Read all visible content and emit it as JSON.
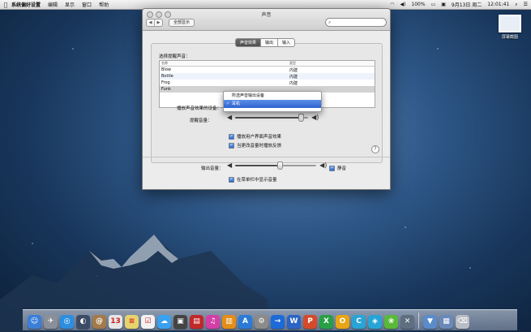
{
  "menubar": {
    "apple": "",
    "items": [
      "系统偏好设置",
      "编辑",
      "显示",
      "窗口",
      "帮助"
    ],
    "status": {
      "battery": "100%",
      "date": "9月13日 周二",
      "time": "12:01:41"
    }
  },
  "desktop": {
    "screenshot_label": "屏幕截图"
  },
  "window": {
    "title": "声音",
    "nav_back": "◀",
    "nav_forward": "▶",
    "show_all": "全部显示",
    "search_placeholder": "",
    "tabs": [
      {
        "label": "声音效果",
        "active": true
      },
      {
        "label": "输出",
        "active": false
      },
      {
        "label": "输入",
        "active": false
      }
    ],
    "alert_heading": "选择提醒声音：",
    "list": {
      "columns": [
        "名称",
        "类型"
      ],
      "rows": [
        {
          "name": "Blow",
          "type": "内建"
        },
        {
          "name": "Bottle",
          "type": "内建"
        },
        {
          "name": "Frog",
          "type": "内建"
        },
        {
          "name": "Funk",
          "type": ""
        }
      ]
    },
    "play_device_label": "播放声音效果的设备：",
    "alert_volume_label": "提醒音量：",
    "alert_volume_level": 0.9,
    "play_ui_effects": "播放用户界面声音效果",
    "play_feedback": "当更改音量时播放反馈",
    "output_volume_label": "输出音量：",
    "output_volume_level": 0.55,
    "mute_label": "静音",
    "show_volume_menubar": "在菜单栏中显示音量",
    "help": "?"
  },
  "popup": {
    "items": [
      {
        "label": "所选声音输出设备",
        "selected": false
      },
      {
        "label": "耳机",
        "selected": true
      }
    ],
    "checkmark": "✓"
  },
  "dock": {
    "apps": [
      {
        "icon": "finder-icon",
        "color": "#3b7fd9",
        "glyph": "☺"
      },
      {
        "icon": "launchpad-icon",
        "color": "#8a8f99",
        "glyph": "✈"
      },
      {
        "icon": "safari-icon",
        "color": "#2d8de0",
        "glyph": "◎"
      },
      {
        "icon": "photo-icon",
        "color": "#3c4b66",
        "glyph": "◐"
      },
      {
        "icon": "contacts-icon",
        "color": "#a37a4a",
        "glyph": "@"
      },
      {
        "icon": "calendar-icon",
        "color": "#e7e7e7",
        "glyph": "13"
      },
      {
        "icon": "notes-icon",
        "color": "#e6d36b",
        "glyph": "≡"
      },
      {
        "icon": "reminders-icon",
        "color": "#f2f2f2",
        "glyph": "☑"
      },
      {
        "icon": "messages-icon",
        "color": "#3aa0f0",
        "glyph": "☁"
      },
      {
        "icon": "facetime-icon",
        "color": "#444",
        "glyph": "▣"
      },
      {
        "icon": "photobooth-icon",
        "color": "#c0282a",
        "glyph": "▤"
      },
      {
        "icon": "itunes-icon",
        "color": "#d43fa6",
        "glyph": "♫"
      },
      {
        "icon": "ibooks-icon",
        "color": "#e58d1a",
        "glyph": "▥"
      },
      {
        "icon": "appstore-icon",
        "color": "#2b7bd6",
        "glyph": "A"
      },
      {
        "icon": "preferences-icon",
        "color": "#8b8b8b",
        "glyph": "⚙"
      },
      {
        "icon": "arrow-icon",
        "color": "#1d6ad9",
        "glyph": "→"
      },
      {
        "icon": "word-icon",
        "color": "#2b64c6",
        "glyph": "W"
      },
      {
        "icon": "powerpoint-icon",
        "color": "#d44a2a",
        "glyph": "P"
      },
      {
        "icon": "excel-icon",
        "color": "#27a045",
        "glyph": "X"
      },
      {
        "icon": "outlook-icon",
        "color": "#e8a516",
        "glyph": "O"
      },
      {
        "icon": "lync-icon",
        "color": "#2aa4d6",
        "glyph": "C"
      },
      {
        "icon": "db-icon",
        "color": "#27a4d6",
        "glyph": "◈"
      },
      {
        "icon": "messenger-icon",
        "color": "#5ab83a",
        "glyph": "❀"
      },
      {
        "icon": "utility-icon",
        "color": "#5f6f80",
        "glyph": "✕"
      },
      {
        "icon": "downloads-icon",
        "color": "#5b8cc9",
        "glyph": "▼"
      },
      {
        "icon": "documents-icon",
        "color": "#6a89b8",
        "glyph": "▦"
      },
      {
        "icon": "trash-icon",
        "color": "#b8bcc4",
        "glyph": "⌫"
      }
    ]
  }
}
